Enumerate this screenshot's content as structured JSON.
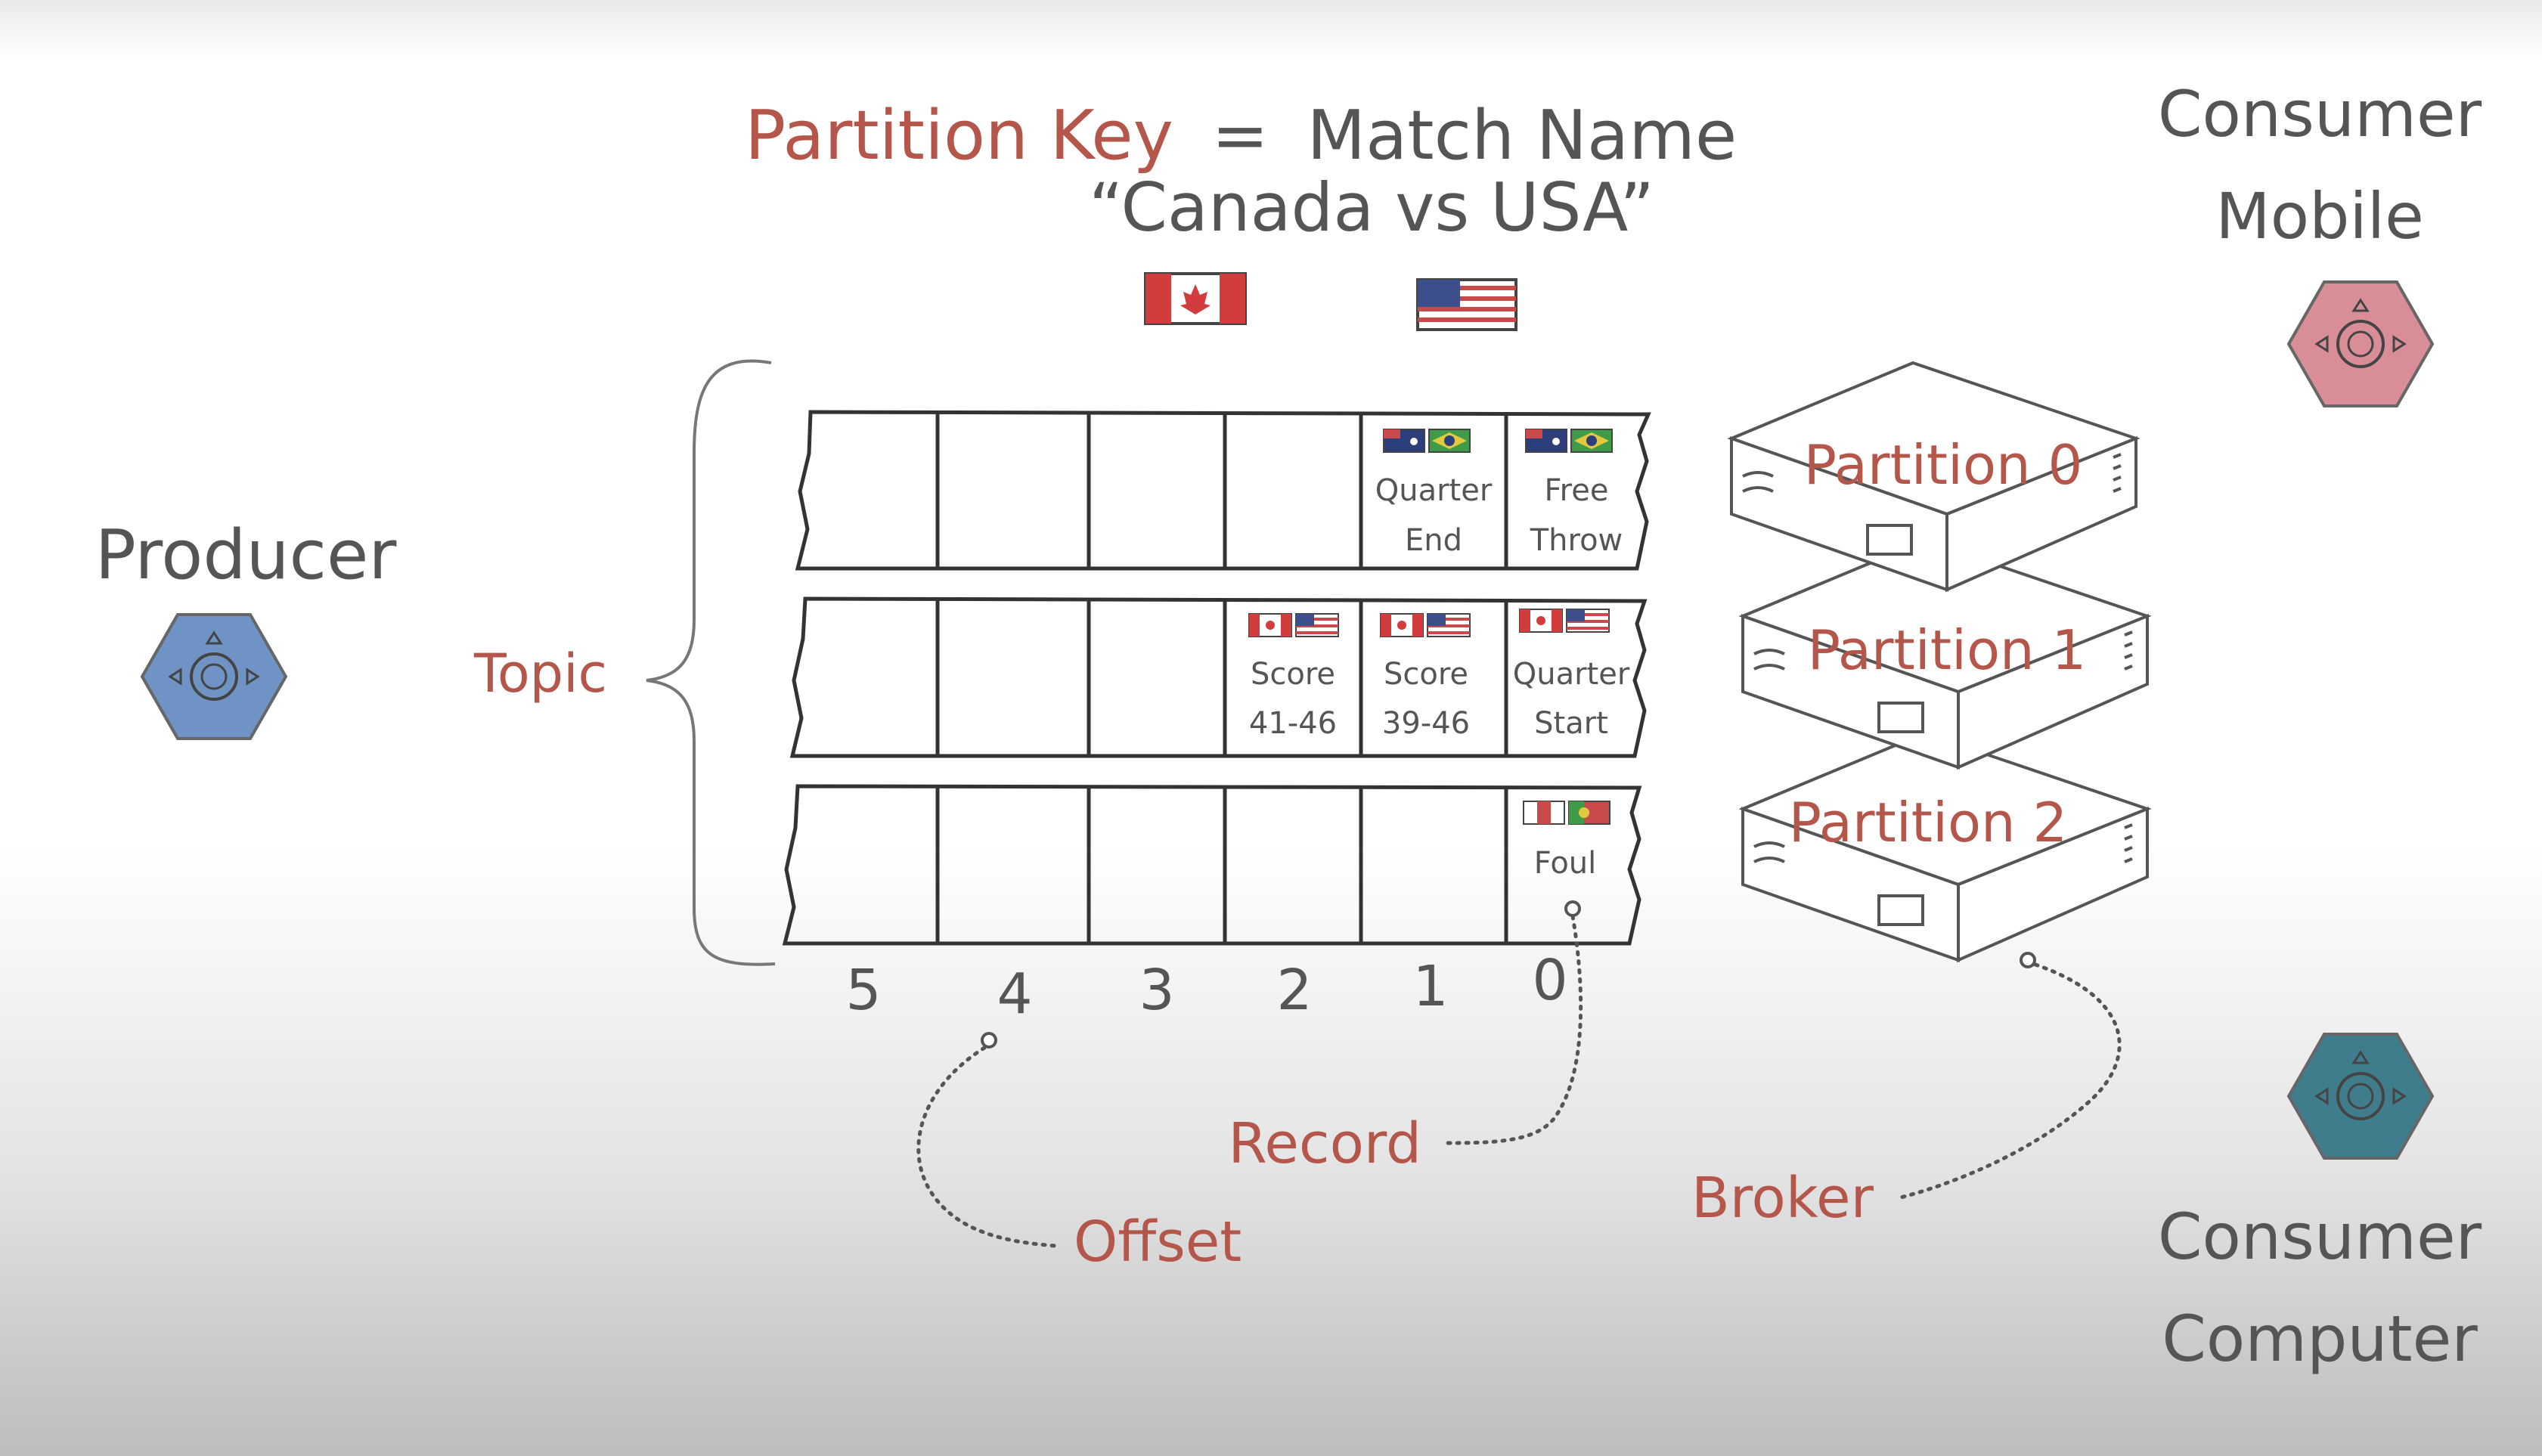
{
  "title": {
    "key_label": "Partition Key",
    "equals": "=",
    "key_value": "Match Name",
    "match": "“Canada vs USA”",
    "flags": [
      "canada",
      "usa"
    ]
  },
  "producer": {
    "label": "Producer",
    "icon": "hexagon-node-icon",
    "color": "#6f93c4"
  },
  "consumers": [
    {
      "line1": "Consumer",
      "line2": "Mobile",
      "icon": "hexagon-node-icon",
      "color": "#d98e97"
    },
    {
      "line1": "Consumer",
      "line2": "Computer",
      "icon": "hexagon-node-icon",
      "color": "#3f7d8c"
    }
  ],
  "topic_label": "Topic",
  "offsets": [
    "5",
    "4",
    "3",
    "2",
    "1",
    "0"
  ],
  "partitions": [
    {
      "name": "Partition 0",
      "records": [
        {
          "offset": 1,
          "line1": "Quarter",
          "line2": "End",
          "flags": [
            "australia",
            "brazil"
          ]
        },
        {
          "offset": 0,
          "line1": "Free",
          "line2": "Throw",
          "flags": [
            "australia",
            "brazil"
          ]
        }
      ]
    },
    {
      "name": "Partition 1",
      "records": [
        {
          "offset": 2,
          "line1": "Score",
          "line2": "41-46",
          "flags": [
            "canada",
            "usa"
          ]
        },
        {
          "offset": 1,
          "line1": "Score",
          "line2": "39-46",
          "flags": [
            "canada",
            "usa"
          ]
        },
        {
          "offset": 0,
          "line1": "Quarter",
          "line2": "Start",
          "flags": [
            "canada",
            "usa"
          ]
        }
      ]
    },
    {
      "name": "Partition 2",
      "records": [
        {
          "offset": 0,
          "line1": "Foul",
          "line2": "",
          "flags": [
            "other",
            "portugal"
          ]
        }
      ]
    }
  ],
  "annotations": {
    "record": "Record",
    "offset": "Offset",
    "broker": "Broker"
  },
  "colors": {
    "accent": "#b4574a",
    "ink": "#555555"
  }
}
